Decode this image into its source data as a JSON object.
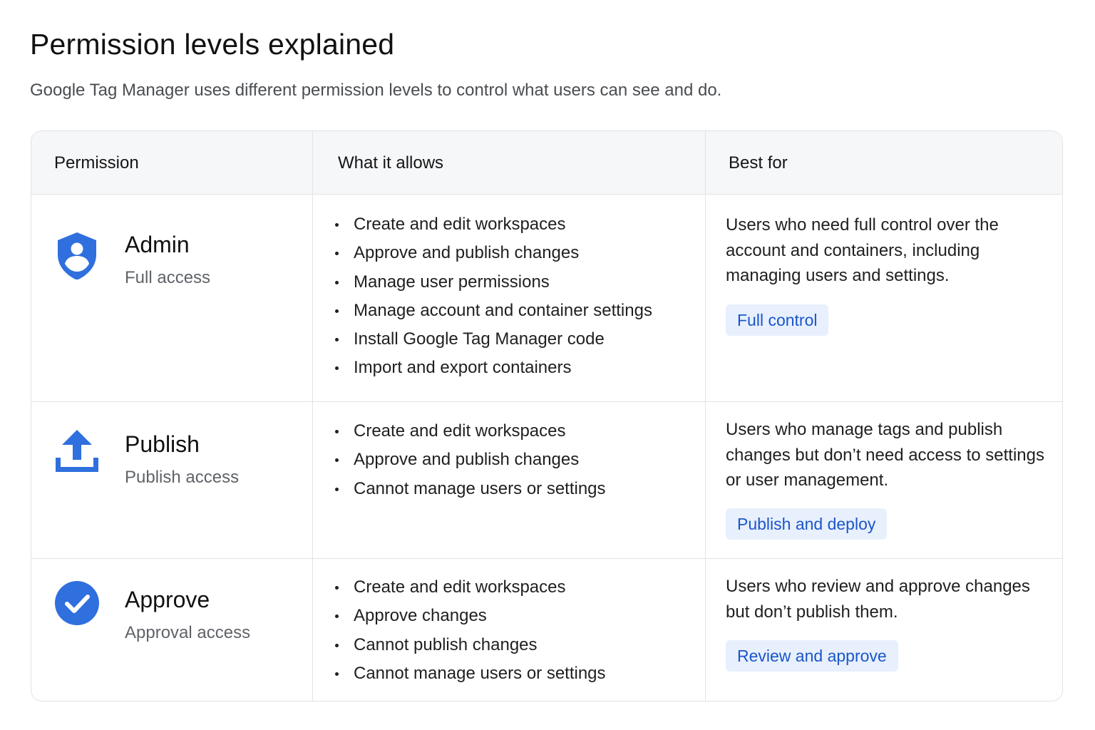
{
  "page": {
    "title": "Permission levels explained",
    "subtitle": "Google Tag Manager uses different permission levels to control what users can see and do."
  },
  "table": {
    "headers": [
      "Permission",
      "What it allows",
      "Best for"
    ],
    "rows": [
      {
        "icon": "shield-user-icon",
        "name": "Admin",
        "access": "Full access",
        "allows": [
          "Create and edit workspaces",
          "Approve and publish changes",
          "Manage user permissions",
          "Manage account and container settings",
          "Install Google Tag Manager code",
          "Import and export containers"
        ],
        "best_for": "Users who need full control over the account and containers, including managing users and settings.",
        "tag": "Full control"
      },
      {
        "icon": "upload-icon",
        "name": "Publish",
        "access": "Publish access",
        "allows": [
          "Create and edit workspaces",
          "Approve and publish changes",
          "Cannot manage users or settings"
        ],
        "best_for": "Users who manage tags and publish changes but don’t need access to settings or user management.",
        "tag": "Publish and deploy"
      },
      {
        "icon": "check-circle-icon",
        "name": "Approve",
        "access": "Approval access",
        "allows": [
          "Create and edit workspaces",
          "Approve changes",
          "Cannot publish changes",
          "Cannot manage users or settings"
        ],
        "best_for": "Users who review and approve changes but don’t publish them.",
        "tag": "Review and approve"
      }
    ]
  },
  "colors": {
    "accent": "#2f6fde",
    "chip_bg": "#e8f0fe",
    "chip_text": "#1a56c9",
    "border": "#e1e3e6",
    "header_bg": "#f6f7f9"
  }
}
